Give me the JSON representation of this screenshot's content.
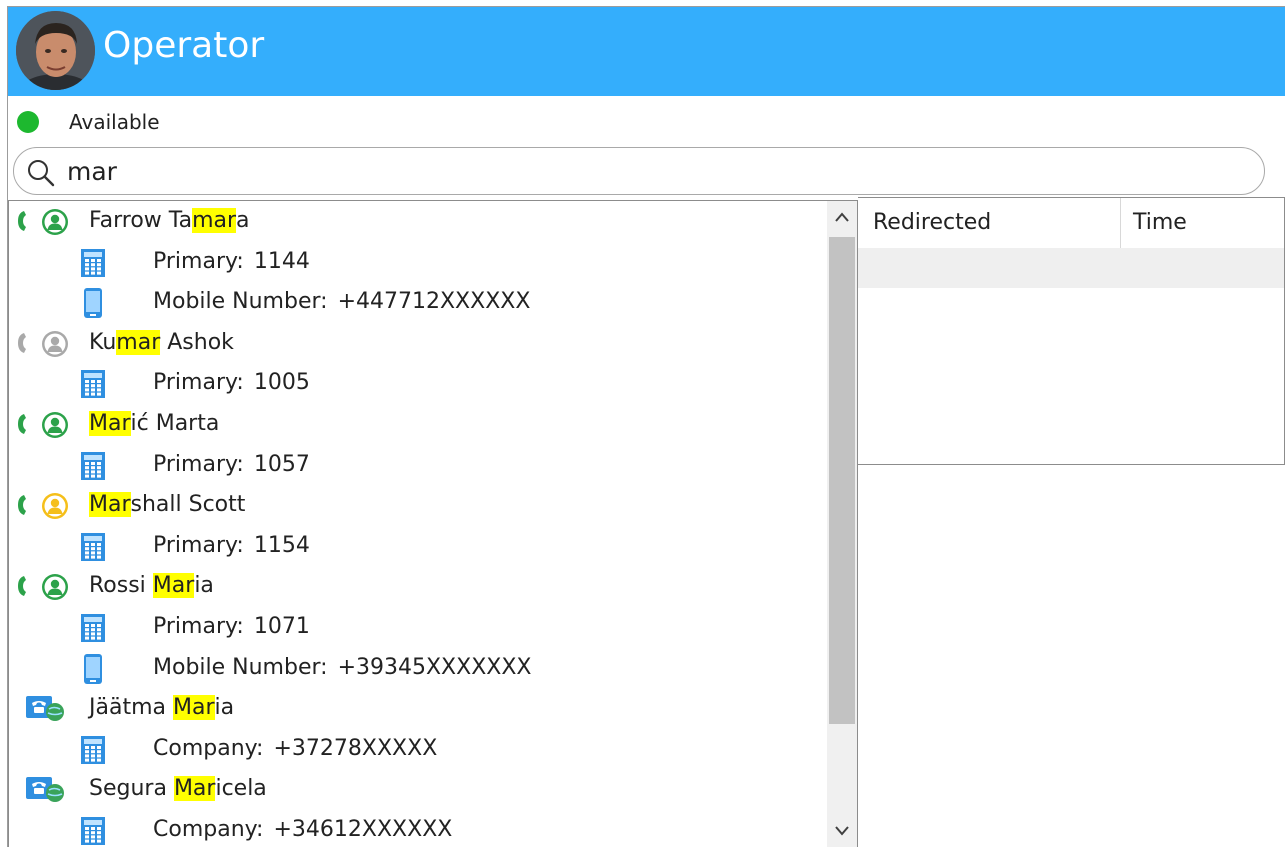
{
  "app": {
    "title": "Operator",
    "accent_color": "#34aefc"
  },
  "status": {
    "label": "Available",
    "color": "#1db82f"
  },
  "search": {
    "value": "mar",
    "icon": "search-icon"
  },
  "results": [
    {
      "type": "contact",
      "name_parts": [
        "Farrow Ta",
        "mar",
        "a"
      ],
      "call_icon": "green",
      "icon": "person-green"
    },
    {
      "type": "phone",
      "device": "deskphone",
      "label": "Primary:",
      "value": "1144"
    },
    {
      "type": "phone",
      "device": "mobile",
      "label": "Mobile Number:",
      "value": "+447712XXXXXX"
    },
    {
      "type": "contact",
      "name_parts": [
        "Ku",
        "mar",
        " Ashok"
      ],
      "call_icon": "gray",
      "icon": "person-gray"
    },
    {
      "type": "phone",
      "device": "deskphone",
      "label": "Primary:",
      "value": "1005"
    },
    {
      "type": "contact",
      "name_parts": [
        "",
        "Mar",
        "ić Marta"
      ],
      "call_icon": "green",
      "icon": "person-green"
    },
    {
      "type": "phone",
      "device": "deskphone",
      "label": "Primary:",
      "value": "1057"
    },
    {
      "type": "contact",
      "name_parts": [
        "",
        "Mar",
        "shall Scott"
      ],
      "call_icon": "green",
      "icon": "person-yellow"
    },
    {
      "type": "phone",
      "device": "deskphone",
      "label": "Primary:",
      "value": "1154"
    },
    {
      "type": "contact",
      "name_parts": [
        "Rossi ",
        "Mar",
        "ia"
      ],
      "call_icon": "green",
      "icon": "person-green"
    },
    {
      "type": "phone",
      "device": "deskphone",
      "label": "Primary:",
      "value": "1071"
    },
    {
      "type": "phone",
      "device": "mobile",
      "label": "Mobile Number:",
      "value": "+39345XXXXXXX"
    },
    {
      "type": "contact",
      "name_parts": [
        "Jäätma ",
        "Mar",
        "ia"
      ],
      "call_icon": "none",
      "icon": "external-contact"
    },
    {
      "type": "phone",
      "device": "deskphone",
      "label": "Company:",
      "value": "+37278XXXXX"
    },
    {
      "type": "contact",
      "name_parts": [
        "Segura ",
        "Mar",
        "icela"
      ],
      "call_icon": "none",
      "icon": "external-contact"
    },
    {
      "type": "phone",
      "device": "deskphone",
      "label": "Company:",
      "value": "+34612XXXXXX"
    }
  ],
  "scrollbar": {
    "up_glyph": "^",
    "down_glyph": "v"
  },
  "history": {
    "columns": [
      "Redirected",
      "Time"
    ]
  }
}
